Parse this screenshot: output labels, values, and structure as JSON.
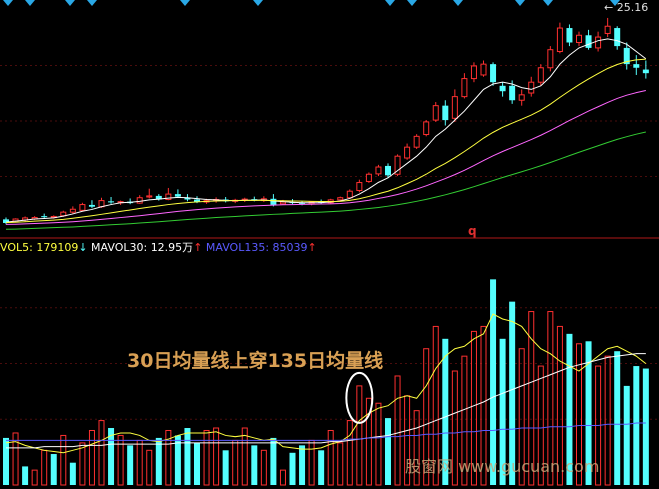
{
  "chart_data": [
    {
      "type": "candlestick",
      "panel": "price",
      "high_marker": "25.16",
      "panel_label": "q",
      "candles": [
        {
          "o": 14.0,
          "h": 14.1,
          "l": 13.72,
          "c": 13.8,
          "up": false
        },
        {
          "o": 13.9,
          "h": 14.06,
          "l": 13.84,
          "c": 14.02,
          "up": true
        },
        {
          "o": 13.96,
          "h": 14.16,
          "l": 13.86,
          "c": 14.08,
          "up": true
        },
        {
          "o": 14.02,
          "h": 14.18,
          "l": 13.96,
          "c": 14.1,
          "up": true
        },
        {
          "o": 14.18,
          "h": 14.32,
          "l": 14.06,
          "c": 14.12,
          "up": false
        },
        {
          "o": 14.1,
          "h": 14.22,
          "l": 14.04,
          "c": 14.16,
          "up": true
        },
        {
          "o": 14.2,
          "h": 14.48,
          "l": 14.14,
          "c": 14.4,
          "up": true
        },
        {
          "o": 14.4,
          "h": 14.72,
          "l": 14.32,
          "c": 14.56,
          "up": true
        },
        {
          "o": 14.5,
          "h": 14.92,
          "l": 14.44,
          "c": 14.82,
          "up": true
        },
        {
          "o": 14.8,
          "h": 15.06,
          "l": 14.62,
          "c": 14.7,
          "up": false
        },
        {
          "o": 14.7,
          "h": 15.2,
          "l": 14.64,
          "c": 15.04,
          "up": true
        },
        {
          "o": 15.0,
          "h": 15.24,
          "l": 14.86,
          "c": 14.94,
          "up": false
        },
        {
          "o": 14.92,
          "h": 15.04,
          "l": 14.8,
          "c": 14.98,
          "up": true
        },
        {
          "o": 14.98,
          "h": 15.16,
          "l": 14.84,
          "c": 14.9,
          "up": false
        },
        {
          "o": 14.9,
          "h": 15.34,
          "l": 14.86,
          "c": 15.2,
          "up": true
        },
        {
          "o": 15.24,
          "h": 15.7,
          "l": 15.16,
          "c": 15.3,
          "up": true
        },
        {
          "o": 15.3,
          "h": 15.4,
          "l": 15.04,
          "c": 15.1,
          "up": false
        },
        {
          "o": 15.1,
          "h": 15.74,
          "l": 15.06,
          "c": 15.4,
          "up": true
        },
        {
          "o": 15.4,
          "h": 15.66,
          "l": 15.2,
          "c": 15.26,
          "up": false
        },
        {
          "o": 15.2,
          "h": 15.4,
          "l": 15.0,
          "c": 15.1,
          "up": false
        },
        {
          "o": 15.1,
          "h": 15.28,
          "l": 14.9,
          "c": 14.96,
          "up": false
        },
        {
          "o": 14.96,
          "h": 15.14,
          "l": 14.86,
          "c": 15.04,
          "up": true
        },
        {
          "o": 15.04,
          "h": 15.22,
          "l": 14.92,
          "c": 15.1,
          "up": true
        },
        {
          "o": 15.1,
          "h": 15.24,
          "l": 14.94,
          "c": 15.0,
          "up": false
        },
        {
          "o": 15.0,
          "h": 15.14,
          "l": 14.9,
          "c": 15.06,
          "up": true
        },
        {
          "o": 15.06,
          "h": 15.2,
          "l": 14.96,
          "c": 15.12,
          "up": true
        },
        {
          "o": 15.12,
          "h": 15.26,
          "l": 15.0,
          "c": 15.04,
          "up": false
        },
        {
          "o": 15.04,
          "h": 15.28,
          "l": 14.96,
          "c": 15.14,
          "up": true
        },
        {
          "o": 15.14,
          "h": 15.4,
          "l": 14.72,
          "c": 14.8,
          "up": false
        },
        {
          "o": 14.86,
          "h": 15.08,
          "l": 14.8,
          "c": 14.96,
          "up": true
        },
        {
          "o": 14.96,
          "h": 15.12,
          "l": 14.84,
          "c": 14.9,
          "up": false
        },
        {
          "o": 14.9,
          "h": 15.0,
          "l": 14.78,
          "c": 14.86,
          "up": false
        },
        {
          "o": 14.86,
          "h": 15.0,
          "l": 14.78,
          "c": 14.96,
          "up": true
        },
        {
          "o": 14.96,
          "h": 15.1,
          "l": 14.86,
          "c": 14.92,
          "up": false
        },
        {
          "o": 14.92,
          "h": 15.14,
          "l": 14.86,
          "c": 15.08,
          "up": true
        },
        {
          "o": 15.08,
          "h": 15.26,
          "l": 15.0,
          "c": 15.2,
          "up": true
        },
        {
          "o": 15.2,
          "h": 15.66,
          "l": 15.14,
          "c": 15.56,
          "up": true
        },
        {
          "o": 15.6,
          "h": 16.2,
          "l": 15.5,
          "c": 16.04,
          "up": true
        },
        {
          "o": 16.1,
          "h": 16.6,
          "l": 16.02,
          "c": 16.5,
          "up": true
        },
        {
          "o": 16.52,
          "h": 17.02,
          "l": 16.4,
          "c": 16.9,
          "up": true
        },
        {
          "o": 16.96,
          "h": 17.1,
          "l": 16.3,
          "c": 16.44,
          "up": false
        },
        {
          "o": 16.5,
          "h": 17.6,
          "l": 16.4,
          "c": 17.5,
          "up": true
        },
        {
          "o": 17.4,
          "h": 18.2,
          "l": 17.3,
          "c": 18.0,
          "up": true
        },
        {
          "o": 18.0,
          "h": 18.72,
          "l": 17.9,
          "c": 18.6,
          "up": true
        },
        {
          "o": 18.7,
          "h": 19.5,
          "l": 18.6,
          "c": 19.4,
          "up": true
        },
        {
          "o": 19.5,
          "h": 20.5,
          "l": 19.4,
          "c": 20.3,
          "up": true
        },
        {
          "o": 20.3,
          "h": 20.6,
          "l": 19.2,
          "c": 19.5,
          "up": false
        },
        {
          "o": 19.6,
          "h": 21.2,
          "l": 19.4,
          "c": 20.8,
          "up": true
        },
        {
          "o": 20.8,
          "h": 22.1,
          "l": 20.7,
          "c": 21.8,
          "up": true
        },
        {
          "o": 21.8,
          "h": 22.7,
          "l": 21.6,
          "c": 22.5,
          "up": true
        },
        {
          "o": 22.0,
          "h": 22.8,
          "l": 21.9,
          "c": 22.6,
          "up": true
        },
        {
          "o": 22.6,
          "h": 22.7,
          "l": 21.4,
          "c": 21.6,
          "up": false
        },
        {
          "o": 21.4,
          "h": 21.6,
          "l": 20.8,
          "c": 21.1,
          "up": false
        },
        {
          "o": 21.4,
          "h": 21.7,
          "l": 20.4,
          "c": 20.6,
          "up": false
        },
        {
          "o": 20.6,
          "h": 21.2,
          "l": 20.3,
          "c": 20.9,
          "up": true
        },
        {
          "o": 21.0,
          "h": 21.9,
          "l": 20.8,
          "c": 21.6,
          "up": true
        },
        {
          "o": 21.6,
          "h": 22.6,
          "l": 21.4,
          "c": 22.4,
          "up": true
        },
        {
          "o": 22.4,
          "h": 23.6,
          "l": 22.2,
          "c": 23.4,
          "up": true
        },
        {
          "o": 23.3,
          "h": 24.9,
          "l": 23.2,
          "c": 24.6,
          "up": true
        },
        {
          "o": 24.6,
          "h": 24.8,
          "l": 23.6,
          "c": 23.8,
          "up": false
        },
        {
          "o": 23.8,
          "h": 24.4,
          "l": 23.6,
          "c": 24.2,
          "up": true
        },
        {
          "o": 24.2,
          "h": 24.5,
          "l": 23.4,
          "c": 23.5,
          "up": false
        },
        {
          "o": 23.5,
          "h": 24.4,
          "l": 23.3,
          "c": 24.1,
          "up": true
        },
        {
          "o": 24.3,
          "h": 25.16,
          "l": 24.1,
          "c": 24.7,
          "up": true
        },
        {
          "o": 24.6,
          "h": 24.7,
          "l": 23.4,
          "c": 23.6,
          "up": false
        },
        {
          "o": 23.5,
          "h": 23.8,
          "l": 22.3,
          "c": 22.6,
          "up": false
        },
        {
          "o": 22.6,
          "h": 23.1,
          "l": 22.0,
          "c": 22.4,
          "up": false
        },
        {
          "o": 22.3,
          "h": 22.8,
          "l": 21.8,
          "c": 22.1,
          "up": false
        }
      ],
      "ma_lines": [
        {
          "color": "#ffffff",
          "values": [
            13.85,
            13.9,
            13.96,
            14.02,
            14.05,
            14.08,
            14.18,
            14.3,
            14.45,
            14.55,
            14.7,
            14.82,
            14.92,
            14.95,
            15.0,
            15.08,
            15.12,
            15.18,
            15.22,
            15.2,
            15.15,
            15.1,
            15.08,
            15.05,
            15.04,
            15.06,
            15.06,
            15.08,
            15.02,
            14.98,
            14.95,
            14.92,
            14.92,
            14.93,
            14.96,
            15.02,
            15.16,
            15.4,
            15.7,
            16.05,
            16.3,
            16.7,
            17.1,
            17.5,
            18.0,
            18.6,
            19.0,
            19.5,
            20.0,
            20.6,
            21.2,
            21.5,
            21.6,
            21.5,
            21.3,
            21.2,
            21.4,
            21.9,
            22.6,
            23.1,
            23.5,
            23.7,
            23.9,
            24.0,
            23.9,
            23.7,
            23.3,
            22.9
          ]
        },
        {
          "color": "#ffff40",
          "values": [
            13.82,
            13.84,
            13.87,
            13.9,
            13.93,
            13.96,
            14.0,
            14.06,
            14.13,
            14.2,
            14.28,
            14.36,
            14.44,
            14.52,
            14.6,
            14.68,
            14.75,
            14.82,
            14.88,
            14.93,
            14.97,
            15.0,
            15.02,
            15.03,
            15.04,
            15.05,
            15.05,
            15.05,
            15.04,
            15.03,
            15.02,
            15.01,
            15.0,
            14.99,
            14.99,
            15.0,
            15.05,
            15.14,
            15.27,
            15.42,
            15.56,
            15.75,
            15.98,
            16.22,
            16.5,
            16.82,
            17.1,
            17.42,
            17.76,
            18.12,
            18.5,
            18.82,
            19.1,
            19.33,
            19.55,
            19.78,
            20.05,
            20.38,
            20.76,
            21.12,
            21.46,
            21.78,
            22.08,
            22.36,
            22.58,
            22.74,
            22.84,
            22.88
          ]
        },
        {
          "color": "#ff66ff",
          "values": [
            13.72,
            13.73,
            13.75,
            13.77,
            13.79,
            13.81,
            13.84,
            13.87,
            13.91,
            13.95,
            14.0,
            14.05,
            14.1,
            14.15,
            14.2,
            14.26,
            14.32,
            14.38,
            14.44,
            14.49,
            14.54,
            14.58,
            14.62,
            14.66,
            14.69,
            14.72,
            14.75,
            14.77,
            14.79,
            14.81,
            14.82,
            14.83,
            14.84,
            14.85,
            14.86,
            14.88,
            14.92,
            14.98,
            15.06,
            15.16,
            15.26,
            15.38,
            15.52,
            15.68,
            15.86,
            16.06,
            16.26,
            16.48,
            16.72,
            16.98,
            17.26,
            17.52,
            17.76,
            17.98,
            18.2,
            18.42,
            18.66,
            18.92,
            19.2,
            19.48,
            19.74,
            20.0,
            20.24,
            20.48,
            20.7,
            20.88,
            21.02,
            21.14
          ]
        },
        {
          "color": "#33cc33",
          "values": [
            13.45,
            13.46,
            13.48,
            13.5,
            13.52,
            13.54,
            13.56,
            13.58,
            13.61,
            13.64,
            13.67,
            13.7,
            13.73,
            13.76,
            13.8,
            13.83,
            13.87,
            13.91,
            13.95,
            13.99,
            14.03,
            14.06,
            14.1,
            14.13,
            14.16,
            14.19,
            14.22,
            14.25,
            14.28,
            14.3,
            14.33,
            14.35,
            14.38,
            14.4,
            14.43,
            14.46,
            14.5,
            14.55,
            14.6,
            14.66,
            14.73,
            14.81,
            14.9,
            15.0,
            15.11,
            15.23,
            15.36,
            15.5,
            15.65,
            15.81,
            15.98,
            16.15,
            16.32,
            16.48,
            16.64,
            16.8,
            16.97,
            17.15,
            17.34,
            17.53,
            17.72,
            17.9,
            18.08,
            18.26,
            18.43,
            18.58,
            18.72,
            18.84
          ]
        }
      ],
      "ylim": [
        13.3,
        25.6
      ]
    },
    {
      "type": "bar",
      "panel": "volume",
      "legend": {
        "vol5_label": "VOL5: ",
        "vol5_value": "179109",
        "vol5_arrow": "↓",
        "mavol30_label": "MAVOL30: ",
        "mavol30_value": "12.95万",
        "mavol30_arrow": "↑",
        "mavol135_label": "MAVOL135: ",
        "mavol135_value": "85039",
        "mavol135_arrow": "↑"
      },
      "values": [
        38,
        42,
        15,
        12,
        28,
        25,
        40,
        18,
        34,
        44,
        52,
        46,
        40,
        32,
        36,
        28,
        38,
        44,
        40,
        46,
        34,
        44,
        46,
        28,
        36,
        46,
        32,
        28,
        38,
        12,
        26,
        32,
        36,
        28,
        44,
        34,
        52,
        80,
        70,
        66,
        54,
        88,
        72,
        60,
        110,
        128,
        118,
        92,
        104,
        124,
        128,
        166,
        118,
        148,
        110,
        140,
        96,
        140,
        128,
        122,
        114,
        116,
        96,
        104,
        108,
        80,
        96,
        94
      ],
      "up": [
        false,
        true,
        false,
        true,
        true,
        false,
        true,
        false,
        true,
        true,
        true,
        false,
        true,
        false,
        true,
        true,
        false,
        true,
        false,
        false,
        false,
        true,
        true,
        false,
        true,
        true,
        false,
        true,
        false,
        true,
        false,
        false,
        true,
        false,
        true,
        true,
        true,
        true,
        true,
        true,
        false,
        true,
        true,
        true,
        true,
        true,
        false,
        true,
        true,
        true,
        true,
        false,
        false,
        false,
        true,
        true,
        true,
        true,
        true,
        false,
        true,
        false,
        true,
        true,
        false,
        false,
        false,
        false
      ],
      "mavol5": [
        34,
        35,
        32,
        30,
        28,
        27,
        26,
        28,
        30,
        33,
        36,
        40,
        42,
        42,
        40,
        36,
        35,
        37,
        40,
        42,
        42,
        42,
        43,
        40,
        39,
        40,
        38,
        36,
        37,
        31,
        30,
        29,
        29,
        30,
        33,
        35,
        40,
        52,
        58,
        62,
        64,
        70,
        72,
        70,
        80,
        94,
        104,
        110,
        112,
        118,
        122,
        138,
        134,
        132,
        128,
        118,
        110,
        106,
        100,
        96,
        92,
        98,
        104,
        110,
        112,
        108,
        104,
        98
      ],
      "mavol30": [
        30,
        30,
        30,
        30,
        31,
        31,
        31,
        31,
        32,
        32,
        32,
        33,
        33,
        33,
        33,
        33,
        33,
        33,
        34,
        34,
        34,
        34,
        34,
        34,
        34,
        34,
        34,
        34,
        34,
        34,
        34,
        34,
        34,
        34,
        35,
        35,
        36,
        37,
        38,
        39,
        40,
        42,
        44,
        46,
        49,
        52,
        55,
        58,
        61,
        64,
        67,
        71,
        74,
        77,
        80,
        83,
        86,
        89,
        92,
        95,
        97,
        99,
        101,
        103,
        104,
        105,
        106,
        106
      ],
      "mavol135": [
        36,
        36,
        36,
        36,
        36,
        36,
        36,
        36,
        36,
        36,
        36,
        36,
        36,
        36,
        36,
        36,
        36,
        36,
        36,
        36,
        36,
        36,
        36,
        36,
        36,
        36,
        36,
        36,
        36,
        36,
        36,
        36,
        36,
        36,
        36,
        36,
        37,
        37,
        38,
        38,
        39,
        39,
        40,
        40,
        41,
        41,
        42,
        42,
        43,
        43,
        44,
        44,
        45,
        45,
        46,
        46,
        46,
        47,
        47,
        47,
        48,
        48,
        48,
        49,
        49,
        49,
        50,
        50
      ],
      "ylim": [
        0,
        180
      ],
      "annotation": "30日均量线上穿135日均量线",
      "highlight_index": 37
    }
  ],
  "watermark": "股窗网 www.gucuan.com",
  "colors": {
    "up": "#ff3030",
    "down": "#54ffff",
    "vol5": "#ffff40",
    "mavol30": "#ffffff",
    "mavol135": "#5a5aff",
    "annotation": "#d9a054"
  }
}
